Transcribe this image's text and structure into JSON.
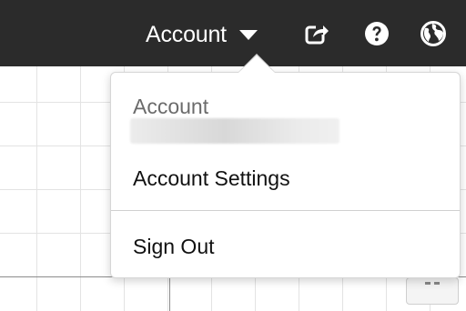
{
  "topbar": {
    "account_label": "Account",
    "icons": [
      "share-icon",
      "help-icon",
      "globe-icon"
    ]
  },
  "dropdown": {
    "header": "Account",
    "email": "",
    "items": [
      {
        "label": "Account Settings"
      },
      {
        "label": "Sign Out"
      }
    ]
  },
  "colors": {
    "topbar_bg": "#2b2b2b",
    "text": "#111111",
    "muted": "#6b6b6b",
    "grid": "#e3e3e3"
  }
}
